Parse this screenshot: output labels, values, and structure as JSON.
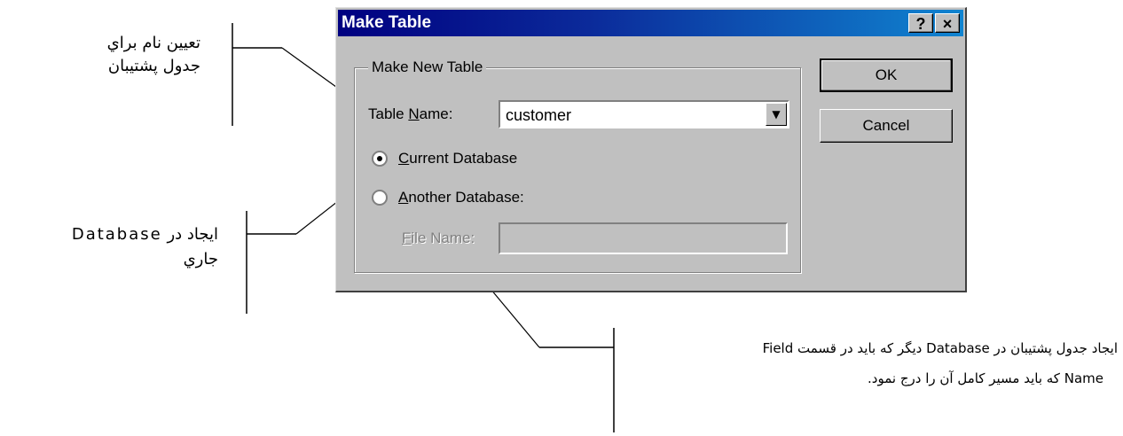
{
  "dialog": {
    "title": "Make Table",
    "help_label": "?",
    "close_label": "×",
    "group_label": "Make New Table",
    "table_name_prefix": "Table ",
    "table_name_access": "N",
    "table_name_rest": "ame:",
    "table_name_value": "customer",
    "current_db_access": "C",
    "current_db_rest": "urrent Database",
    "current_db_selected": true,
    "another_db_access": "A",
    "another_db_rest": "nother Database:",
    "file_name_access": "F",
    "file_name_rest": "ile Name:",
    "file_name_value": "",
    "ok_label": "OK",
    "cancel_label": "Cancel"
  },
  "annotations": {
    "table_name_note_line1": "تعيين نام براي",
    "table_name_note_line2": "جدول پشتيبان",
    "current_db_note_line1": "ايجاد در Database",
    "current_db_note_line2": "جاري",
    "other_db_note_line1": "ايجاد جدول پشتيبان در Database ديگر كه بايد در قسمت  Field",
    "other_db_note_line2": "Name كه بايد مسير كامل آن را درج نمود."
  },
  "colors": {
    "dialog_face": "#c0c0c0",
    "title_start": "#000080",
    "title_end": "#1084d0"
  }
}
